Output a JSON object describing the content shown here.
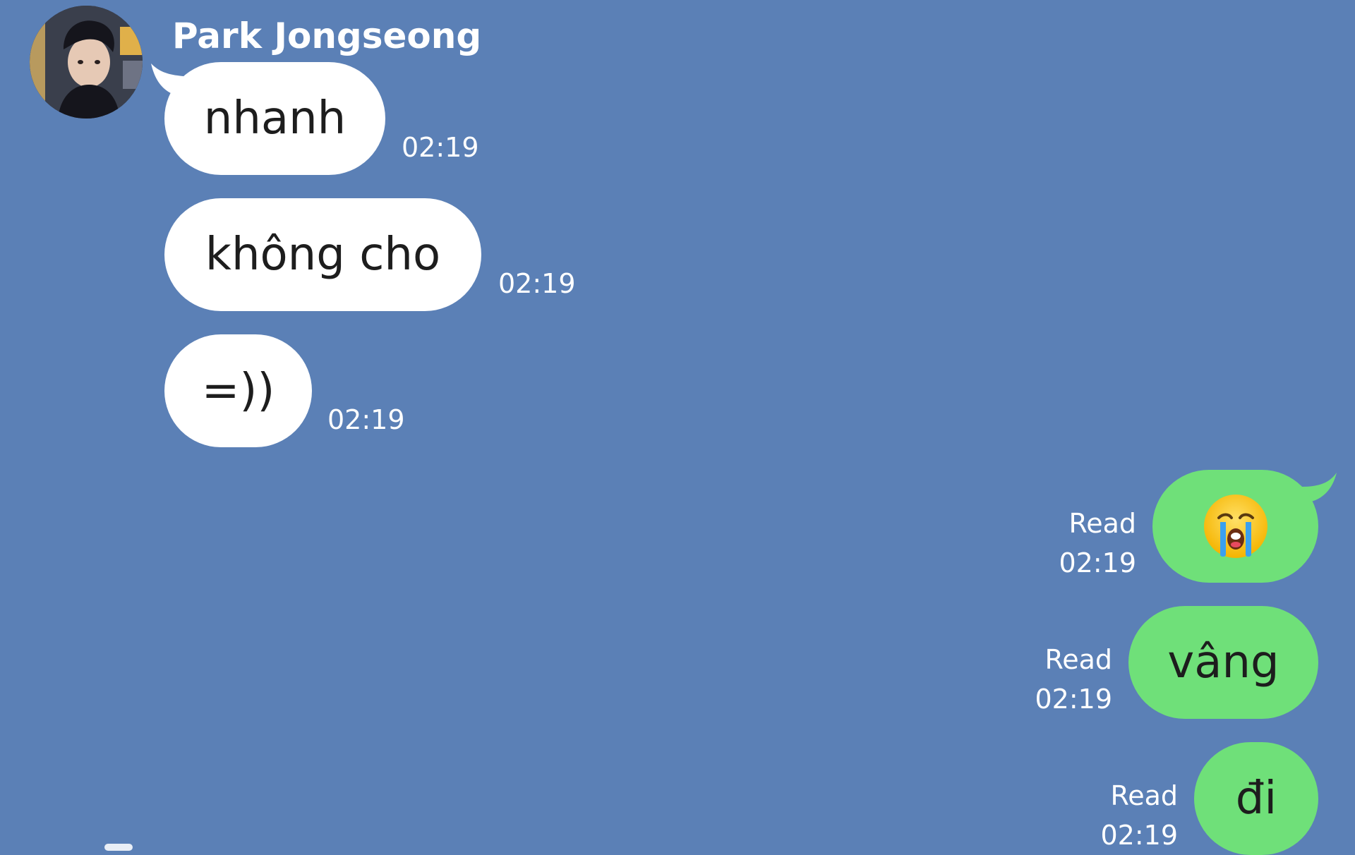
{
  "chat": {
    "contact_name": "Park Jongseong",
    "incoming_messages": [
      {
        "text": "nhanh",
        "time": "02:19"
      },
      {
        "text": "không cho",
        "time": "02:19"
      },
      {
        "text": "=))",
        "time": "02:19"
      }
    ],
    "outgoing_messages": [
      {
        "emoji": "loudly-crying-face",
        "status": "Read",
        "time": "02:19"
      },
      {
        "text": "vâng",
        "status": "Read",
        "time": "02:19"
      },
      {
        "text": "đi",
        "status": "Read",
        "time": "02:19"
      }
    ]
  },
  "colors": {
    "background": "#5b80b6",
    "incoming_bubble": "#ffffff",
    "outgoing_bubble": "#6fe079",
    "meta_text": "#ffffff"
  }
}
